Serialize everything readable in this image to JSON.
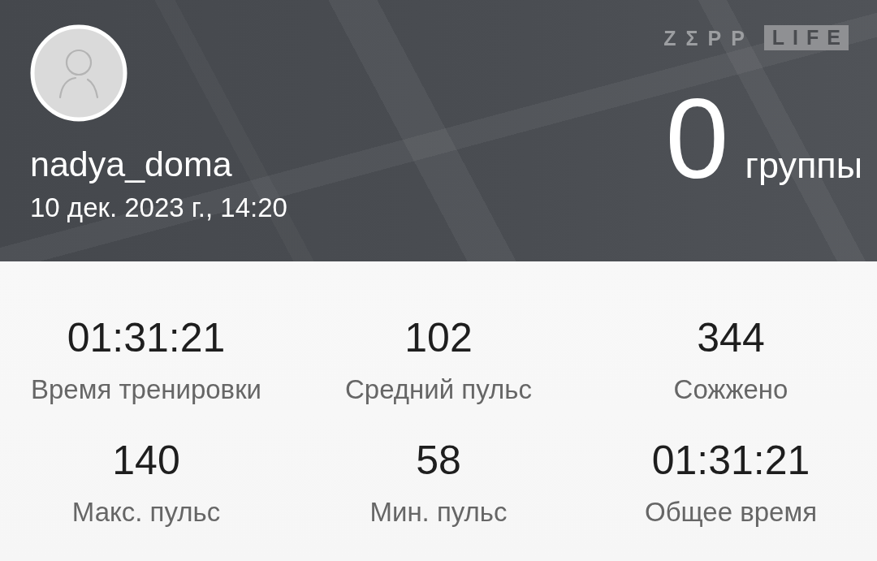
{
  "header": {
    "username": "nadya_doma",
    "datetime": "10 дек. 2023 г., 14:20",
    "logo": {
      "word_1": "ZΣPP",
      "word_2": "LIFE"
    },
    "count": {
      "value": "0",
      "unit": "группы"
    }
  },
  "stats": [
    {
      "value": "01:31:21",
      "label": "Время тренировки"
    },
    {
      "value": "102",
      "label": "Средний пульс"
    },
    {
      "value": "344",
      "label": "Сожжено"
    },
    {
      "value": "140",
      "label": "Макс. пульс"
    },
    {
      "value": "58",
      "label": "Мин. пульс"
    },
    {
      "value": "01:31:21",
      "label": "Общее время"
    }
  ]
}
